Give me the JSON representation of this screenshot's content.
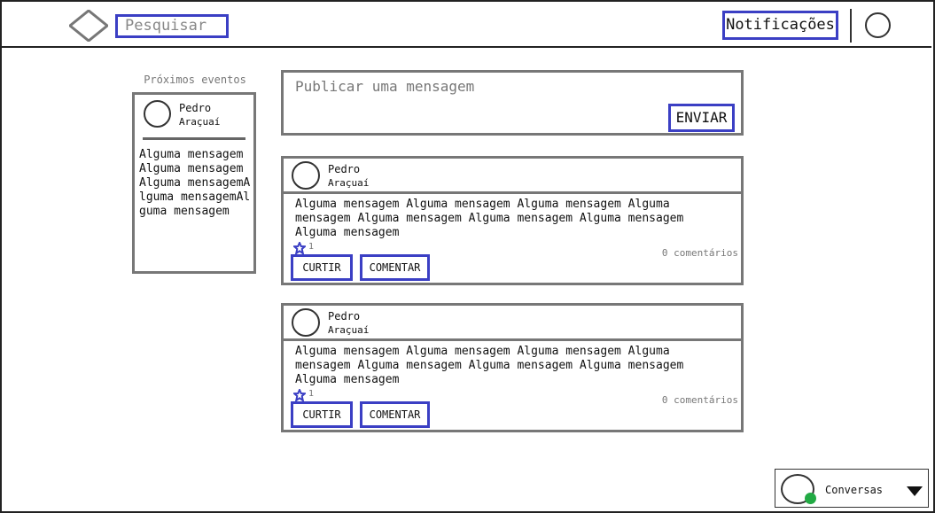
{
  "header": {
    "search_placeholder": "Pesquisar",
    "notifications_label": "Notificações"
  },
  "sidebar": {
    "events_title": "Próximos eventos",
    "event": {
      "name": "Pedro",
      "city": "Araçuaí",
      "message": "Alguma mensagem Alguma mensagem Alguma mensagemAlguma mensagemAlguma mensagem"
    }
  },
  "composer": {
    "placeholder": "Publicar uma mensagem",
    "send_label": "ENVIAR"
  },
  "posts": [
    {
      "name": "Pedro",
      "city": "Araçuaí",
      "body": "Alguma mensagem Alguma mensagem Alguma mensagem Alguma mensagem Alguma mensagem Alguma mensagem Alguma mensagem Alguma mensagem",
      "likes": "1",
      "comments": "0 comentários",
      "like_label": "CURTIR",
      "comment_label": "COMENTAR"
    },
    {
      "name": "Pedro",
      "city": "Araçuaí",
      "body": "Alguma mensagem Alguma mensagem Alguma mensagem Alguma mensagem Alguma mensagem Alguma mensagem Alguma mensagem Alguma mensagem",
      "likes": "1",
      "comments": "0 comentários",
      "like_label": "CURTIR",
      "comment_label": "COMENTAR"
    }
  ],
  "chat": {
    "label": "Conversas",
    "status_color": "#22aa44"
  },
  "colors": {
    "accent_border": "#3b3fc4",
    "card_border": "#777777"
  },
  "icons": {
    "logo": "diamond-logo-icon",
    "profile": "avatar-circle-icon",
    "like": "star-icon",
    "dropdown": "caret-down-icon"
  }
}
